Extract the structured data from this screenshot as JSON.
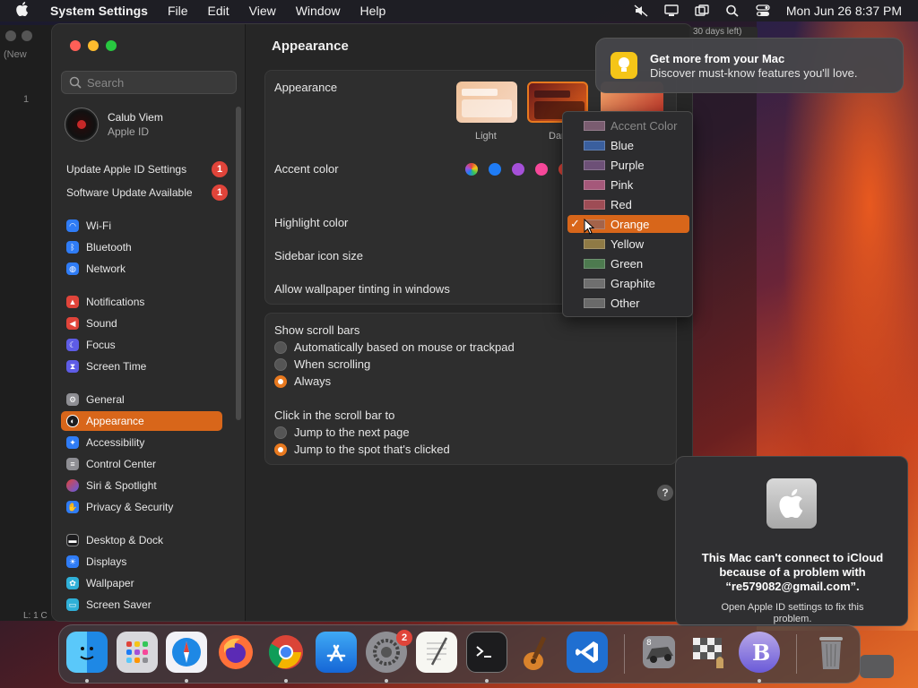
{
  "menubar": {
    "app_name": "System Settings",
    "items": [
      "File",
      "Edit",
      "View",
      "Window",
      "Help"
    ],
    "clock": "Mon Jun 26  8:37 PM"
  },
  "back_window": {
    "tab_label": "(New",
    "line_number": "1",
    "status": "L: 1 C"
  },
  "sidebar": {
    "search_placeholder": "Search",
    "profile": {
      "name": "Calub Viem",
      "subtitle": "Apple ID"
    },
    "notices": [
      {
        "label": "Update Apple ID Settings",
        "badge": "1"
      },
      {
        "label": "Software Update Available",
        "badge": "1"
      }
    ],
    "items": [
      {
        "label": "Wi-Fi",
        "color": "#2f7cf6"
      },
      {
        "label": "Bluetooth",
        "color": "#2f7cf6"
      },
      {
        "label": "Network",
        "color": "#2f7cf6"
      },
      {
        "label": "Notifications",
        "color": "#e0443a"
      },
      {
        "label": "Sound",
        "color": "#e0443a"
      },
      {
        "label": "Focus",
        "color": "#5e5ce6"
      },
      {
        "label": "Screen Time",
        "color": "#5e5ce6"
      },
      {
        "label": "General",
        "color": "#8e8e93"
      },
      {
        "label": "Appearance",
        "color": "#1c1c1e"
      },
      {
        "label": "Accessibility",
        "color": "#2f7cf6"
      },
      {
        "label": "Control Center",
        "color": "#8e8e93"
      },
      {
        "label": "Siri & Spotlight",
        "color": "#a550d8"
      },
      {
        "label": "Privacy & Security",
        "color": "#2f7cf6"
      },
      {
        "label": "Desktop & Dock",
        "color": "#1c1c1e"
      },
      {
        "label": "Displays",
        "color": "#2f7cf6"
      },
      {
        "label": "Wallpaper",
        "color": "#2fb0d8"
      },
      {
        "label": "Screen Saver",
        "color": "#2fb0d8"
      }
    ],
    "active_item": "Appearance"
  },
  "content": {
    "title": "Appearance",
    "appearance_label": "Appearance",
    "thumb_light_label": "Light",
    "thumb_dark_label": "Dar",
    "accent_label": "Accent color",
    "highlight_label": "Highlight color",
    "sidebar_icon_label": "Sidebar icon size",
    "wallpaper_tint_label": "Allow wallpaper tinting in windows",
    "scroll_bars_label": "Show scroll bars",
    "scroll_options": [
      "Automatically based on mouse or trackpad",
      "When scrolling",
      "Always"
    ],
    "scroll_selected": 2,
    "click_label": "Click in the scroll bar to",
    "click_options": [
      "Jump to the next page",
      "Jump to the spot that's clicked"
    ],
    "click_selected": 1,
    "accent_swatches": [
      "multicolor",
      "#1f7cf5",
      "#a550d8",
      "#f7489a",
      "#e0443a"
    ]
  },
  "dropdown": {
    "items": [
      {
        "label": "Accent Color",
        "swatch": "#7a5c70",
        "disabled": true
      },
      {
        "label": "Blue",
        "swatch": "#3a5f9e"
      },
      {
        "label": "Purple",
        "swatch": "#6d5077"
      },
      {
        "label": "Pink",
        "swatch": "#a5587a"
      },
      {
        "label": "Red",
        "swatch": "#9e4c55"
      },
      {
        "label": "Orange",
        "swatch": "#a4634a",
        "selected": true
      },
      {
        "label": "Yellow",
        "swatch": "#8f7a45"
      },
      {
        "label": "Green",
        "swatch": "#4d7a4f"
      },
      {
        "label": "Graphite",
        "swatch": "#6f6f6f"
      },
      {
        "label": "Other",
        "swatch": "#6a6a6a"
      }
    ]
  },
  "notification": {
    "title": "Get more from your Mac",
    "body": "Discover must-know features you'll love.",
    "tab_fragment": "30 days left)"
  },
  "icloud_dialog": {
    "message": "This Mac can't connect to iCloud because of a problem with “re579082@gmail.com”.",
    "sub": "Open Apple ID settings to fix this problem."
  },
  "dock": {
    "settings_badge": "2"
  }
}
